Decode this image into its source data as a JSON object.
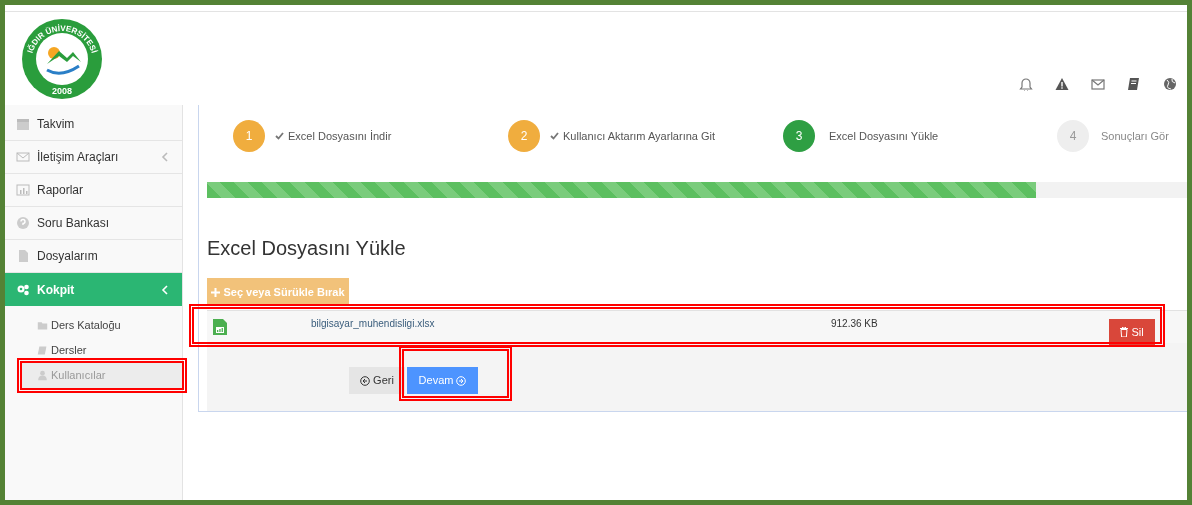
{
  "logo": {
    "text": "IĞDIR ÜNİVERSİTESİ",
    "year": "2008"
  },
  "sidebar": {
    "items": [
      {
        "label": "Takvim",
        "selected": false,
        "has_caret": false
      },
      {
        "label": "İletişim Araçları",
        "selected": false,
        "has_caret": true
      },
      {
        "label": "Raporlar",
        "selected": false,
        "has_caret": false
      },
      {
        "label": "Soru Bankası",
        "selected": false,
        "has_caret": false
      },
      {
        "label": "Dosyalarım",
        "selected": false,
        "has_caret": false
      },
      {
        "label": "Kokpit",
        "selected": true,
        "has_caret": true,
        "children": [
          {
            "label": "Ders Kataloğu",
            "selected": false,
            "highlighted": false
          },
          {
            "label": "Dersler",
            "selected": false,
            "highlighted": false
          },
          {
            "label": "Kullanıcılar",
            "selected": true,
            "highlighted": true
          }
        ]
      }
    ]
  },
  "steps": [
    {
      "number": "1",
      "label": "Excel Dosyasını İndir",
      "done": true,
      "selected": false
    },
    {
      "number": "2",
      "label": "Kullanıcı Aktarım Ayarlarına Git",
      "done": true,
      "selected": false
    },
    {
      "number": "3",
      "label": "Excel Dosyasını Yükle",
      "done": false,
      "selected": true
    },
    {
      "number": "4",
      "label": "Sonuçları Gör",
      "done": false,
      "selected": false
    }
  ],
  "progress": {
    "level": 0.846
  },
  "heading": "Excel Dosyasını Yükle",
  "upload_button": "Seç veya Sürükle Bırak",
  "files": [
    {
      "name": "bilgisayar_muhendisligi.xlsx",
      "size": "912.36 KB",
      "delete_label": "Sil",
      "highlighted": true
    }
  ],
  "buttons": [
    {
      "kind": "back",
      "label": "Geri",
      "highlighted": false
    },
    {
      "kind": "next",
      "label": "Devam",
      "highlighted": true
    }
  ]
}
